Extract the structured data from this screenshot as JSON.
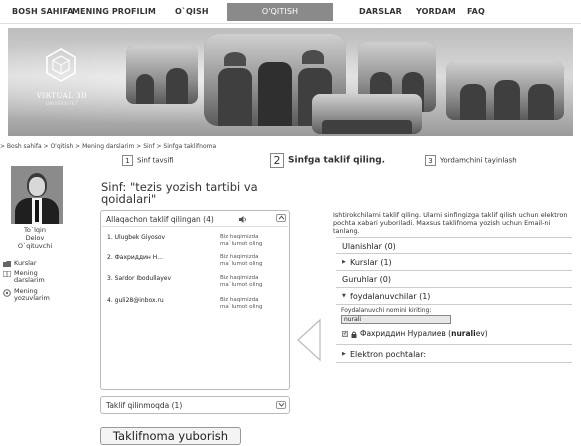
{
  "nav": {
    "items": [
      {
        "label": "BOSH SAHIFA"
      },
      {
        "label": "MENING PROFILIM"
      },
      {
        "label": "O`QISH"
      },
      {
        "label": "O'QITISH"
      },
      {
        "label": "DARSLAR"
      },
      {
        "label": "YORDAM"
      },
      {
        "label": "FAQ"
      }
    ],
    "active_index": 3
  },
  "banner": {
    "logo_text": "VIRTUAL 3D",
    "logo_sub": "UNIVERSITET"
  },
  "breadcrumb": "> Bosh sahifa > O'qitish > Mening darslarim > Sinf > Sinfga taklifnoma",
  "steps": [
    {
      "num": "1",
      "label": "Sinf tavsifi"
    },
    {
      "num": "2",
      "label": "Sinfga taklif qiling."
    },
    {
      "num": "3",
      "label": "Yordamchini tayinlash"
    }
  ],
  "profile": {
    "name_line1": "To`lqin",
    "name_line2": "Delov",
    "role": "O`qituvchi"
  },
  "sidebar": {
    "items": [
      {
        "label": "Kurslar",
        "icon": "folder-icon"
      },
      {
        "label": "Mening darslarim",
        "icon": "book-icon"
      },
      {
        "label": "Mening yozuvlarim",
        "icon": "target-icon"
      }
    ]
  },
  "class_title": "Sinf:  \"tezis yozish tartibi va qoidalari\"",
  "invited": {
    "header": "Allaqachon taklif qilingan (4)",
    "rows": [
      {
        "name": "1. Ulugbek Giyosov",
        "status": "Biz haqimizda ma`lumot oling"
      },
      {
        "name": "2. Фахриддин Н...",
        "status": "Biz haqimizda ma`lumot oling"
      },
      {
        "name": "3. Sardor Ibodullayev",
        "status": "Biz haqimizda ma`lumot oling"
      },
      {
        "name": "4. guli28@inbox.ru",
        "status": "Biz haqimizda ma`lumot oling"
      }
    ]
  },
  "pending": {
    "header": "Taklif qilinmoqda (1)"
  },
  "send_button": "Taklifnoma yuborish",
  "intro": "Ishtirokchilarni taklif qiling. Ularni sinfingizga taklif qilish uchun elektron pochta xabari yuboriladi. Maxsus taklifnoma yozish uchun Email-ni tanlang.",
  "accordion": {
    "connections": "Ulanishlar (0)",
    "courses": "Kurslar (1)",
    "groups": "Guruhlar (0)",
    "users": "foydalanuvchilar (1)",
    "user_search_label": "Foydalanuvchi nomini kiriting:",
    "user_search_value": "nurali",
    "result_prefix": "Фахриддин Нуралиев (",
    "result_bold": "nurali",
    "result_suffix": "ev)",
    "emails": "Elektron pochtalar:"
  }
}
